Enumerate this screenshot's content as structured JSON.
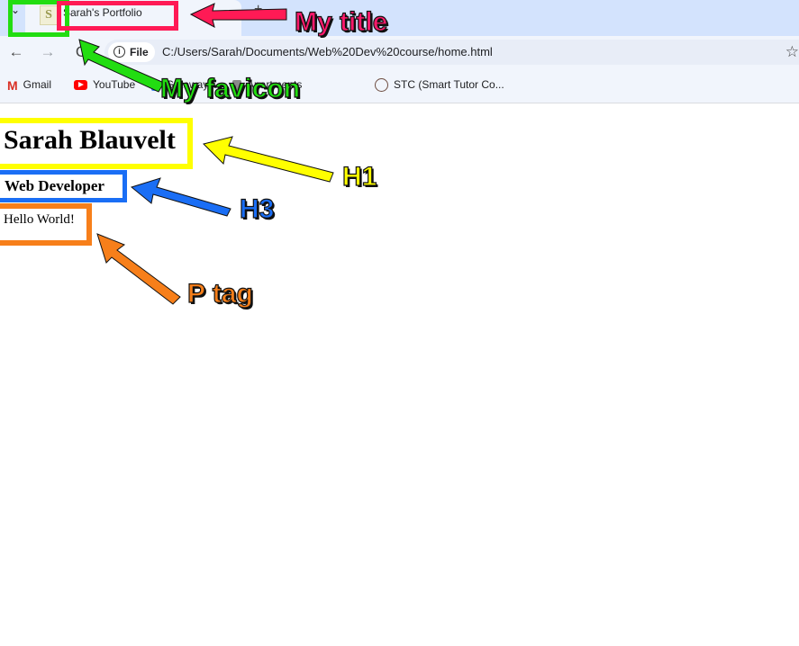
{
  "tab": {
    "title": "Sarah's Portfolio",
    "favicon_letter": "S"
  },
  "toolbar": {
    "back_glyph": "←",
    "forward_glyph": "→",
    "reload_glyph": "C",
    "info_glyph": "i",
    "scheme_label": "File",
    "url": "C:/Users/Sarah/Documents/Web%20Dev%20course/home.html",
    "star_glyph": "☆"
  },
  "bookmarks": [
    {
      "label": "Gmail",
      "icon": "gmail-icon"
    },
    {
      "label": "YouTube",
      "icon": "youtube-icon"
    },
    {
      "label": "Gateway...",
      "icon": "bookmark-icon"
    },
    {
      "label": "Apartments",
      "icon": "bookmark-icon"
    },
    {
      "label": "STC (Smart Tutor Co...",
      "icon": "stc-icon"
    }
  ],
  "page": {
    "h1": "Sarah Blauvelt",
    "h3": "Web Developer",
    "p": "Hello World!"
  },
  "annotations": {
    "title_label": "My title",
    "favicon_label": "My favicon",
    "h1_label": "H1",
    "h3_label": "H3",
    "p_label": "P tag"
  },
  "colors": {
    "title_annotation": "#ff1a6c",
    "favicon_annotation": "#22dd11",
    "h1_annotation": "#ffff00",
    "h3_annotation": "#1a6ef5",
    "p_annotation": "#f77f1a"
  }
}
